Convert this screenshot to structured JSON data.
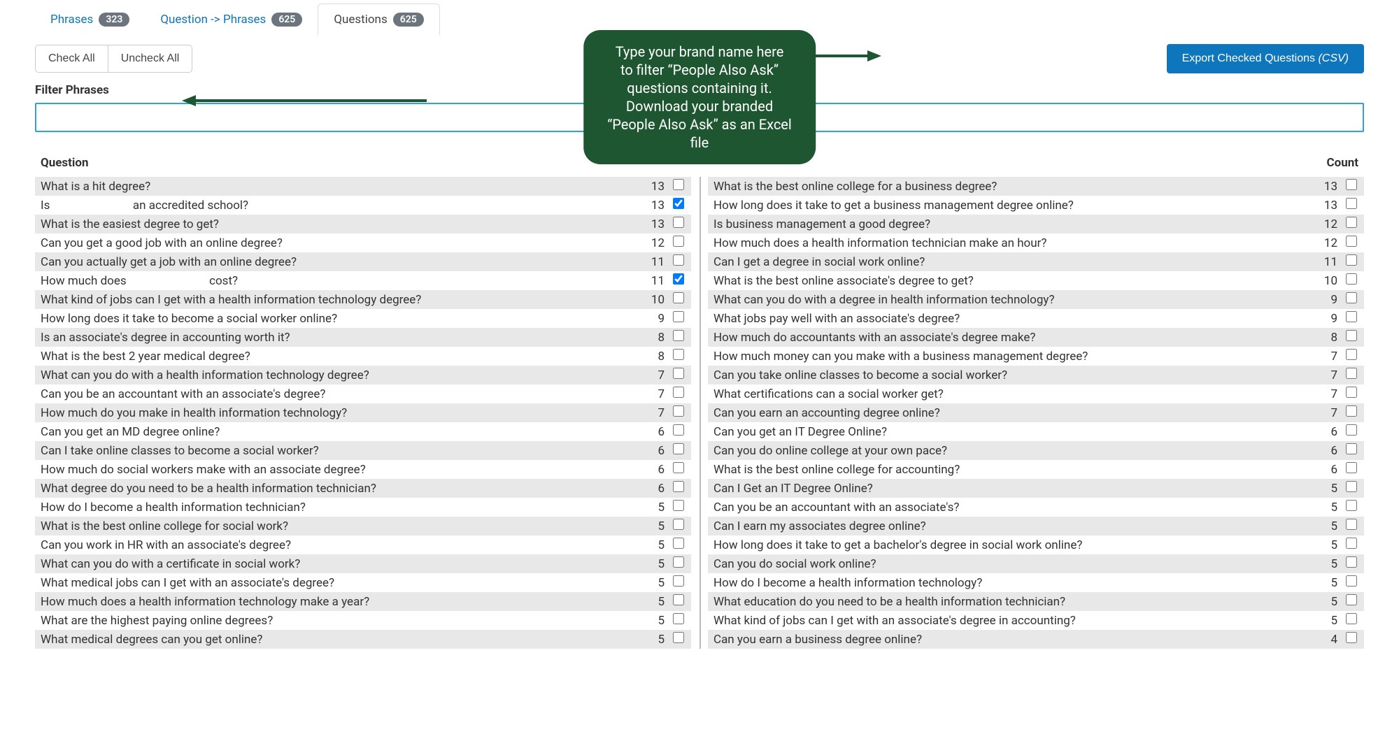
{
  "tabs": [
    {
      "label": "Phrases",
      "count": "323",
      "active": false
    },
    {
      "label": "Question -> Phrases",
      "count": "625",
      "active": false
    },
    {
      "label": "Questions",
      "count": "625",
      "active": true
    }
  ],
  "toolbar": {
    "check_all": "Check All",
    "uncheck_all": "Uncheck All",
    "export": "Export Checked Questions ",
    "export_suffix": "(CSV)"
  },
  "filter": {
    "label": "Filter Phrases",
    "value": ""
  },
  "annotation": "Type your brand name here\nto filter “People Also Ask”\nquestions containing it.\nDownload your branded\n“People Also Ask” as an Excel\nfile",
  "headers": {
    "question": "Question",
    "count": "Count"
  },
  "left": [
    {
      "q": "What is a hit degree?",
      "c": 13,
      "chk": false
    },
    {
      "q": "Is ___ an accredited school?",
      "c": 13,
      "chk": true,
      "redact": [
        3,
        4
      ]
    },
    {
      "q": "What is the easiest degree to get?",
      "c": 13,
      "chk": false
    },
    {
      "q": "Can you get a good job with an online degree?",
      "c": 12,
      "chk": false
    },
    {
      "q": "Can you actually get a job with an online degree?",
      "c": 11,
      "chk": false
    },
    {
      "q": "How much does ___ cost?",
      "c": 11,
      "chk": true,
      "redact": [
        14,
        17
      ]
    },
    {
      "q": "What kind of jobs can I get with a health information technology degree?",
      "c": 10,
      "chk": false
    },
    {
      "q": "How long does it take to become a social worker online?",
      "c": 9,
      "chk": false
    },
    {
      "q": "Is an associate's degree in accounting worth it?",
      "c": 8,
      "chk": false
    },
    {
      "q": "What is the best 2 year medical degree?",
      "c": 8,
      "chk": false
    },
    {
      "q": "What can you do with a health information technology degree?",
      "c": 7,
      "chk": false
    },
    {
      "q": "Can you be an accountant with an associate's degree?",
      "c": 7,
      "chk": false
    },
    {
      "q": "How much do you make in health information technology?",
      "c": 7,
      "chk": false
    },
    {
      "q": "Can you get an MD degree online?",
      "c": 6,
      "chk": false
    },
    {
      "q": "Can I take online classes to become a social worker?",
      "c": 6,
      "chk": false
    },
    {
      "q": "How much do social workers make with an associate degree?",
      "c": 6,
      "chk": false
    },
    {
      "q": "What degree do you need to be a health information technician?",
      "c": 6,
      "chk": false
    },
    {
      "q": "How do I become a health information technician?",
      "c": 5,
      "chk": false
    },
    {
      "q": "What is the best online college for social work?",
      "c": 5,
      "chk": false
    },
    {
      "q": "Can you work in HR with an associate's degree?",
      "c": 5,
      "chk": false
    },
    {
      "q": "What can you do with a certificate in social work?",
      "c": 5,
      "chk": false
    },
    {
      "q": "What medical jobs can I get with an associate's degree?",
      "c": 5,
      "chk": false
    },
    {
      "q": "How much does a health information technology make a year?",
      "c": 5,
      "chk": false
    },
    {
      "q": "What are the highest paying online degrees?",
      "c": 5,
      "chk": false
    },
    {
      "q": "What medical degrees can you get online?",
      "c": 5,
      "chk": false
    }
  ],
  "right": [
    {
      "q": "What is the best online college for a business degree?",
      "c": 13,
      "chk": false
    },
    {
      "q": "How long does it take to get a business management degree online?",
      "c": 13,
      "chk": false
    },
    {
      "q": "Is business management a good degree?",
      "c": 12,
      "chk": false
    },
    {
      "q": "How much does a health information technician make an hour?",
      "c": 12,
      "chk": false
    },
    {
      "q": "Can I get a degree in social work online?",
      "c": 11,
      "chk": false
    },
    {
      "q": "What is the best online associate's degree to get?",
      "c": 10,
      "chk": false
    },
    {
      "q": "What can you do with a degree in health information technology?",
      "c": 9,
      "chk": false
    },
    {
      "q": "What jobs pay well with an associate's degree?",
      "c": 9,
      "chk": false
    },
    {
      "q": "How much do accountants with an associate's degree make?",
      "c": 8,
      "chk": false
    },
    {
      "q": "How much money can you make with a business management degree?",
      "c": 7,
      "chk": false
    },
    {
      "q": "Can you take online classes to become a social worker?",
      "c": 7,
      "chk": false
    },
    {
      "q": "What certifications can a social worker get?",
      "c": 7,
      "chk": false
    },
    {
      "q": "Can you earn an accounting degree online?",
      "c": 7,
      "chk": false
    },
    {
      "q": "Can you get an IT Degree Online?",
      "c": 6,
      "chk": false
    },
    {
      "q": "Can you do online college at your own pace?",
      "c": 6,
      "chk": false
    },
    {
      "q": "What is the best online college for accounting?",
      "c": 6,
      "chk": false
    },
    {
      "q": "Can I Get an IT Degree Online?",
      "c": 5,
      "chk": false
    },
    {
      "q": "Can you be an accountant with an associate's?",
      "c": 5,
      "chk": false
    },
    {
      "q": "Can I earn my associates degree online?",
      "c": 5,
      "chk": false
    },
    {
      "q": "How long does it take to get a bachelor's degree in social work online?",
      "c": 5,
      "chk": false
    },
    {
      "q": "Can you do social work online?",
      "c": 5,
      "chk": false
    },
    {
      "q": "How do I become a health information technology?",
      "c": 5,
      "chk": false
    },
    {
      "q": "What education do you need to be a health information technician?",
      "c": 5,
      "chk": false
    },
    {
      "q": "What kind of jobs can I get with an associate's degree in accounting?",
      "c": 5,
      "chk": false
    },
    {
      "q": "Can you earn a business degree online?",
      "c": 4,
      "chk": false
    }
  ]
}
